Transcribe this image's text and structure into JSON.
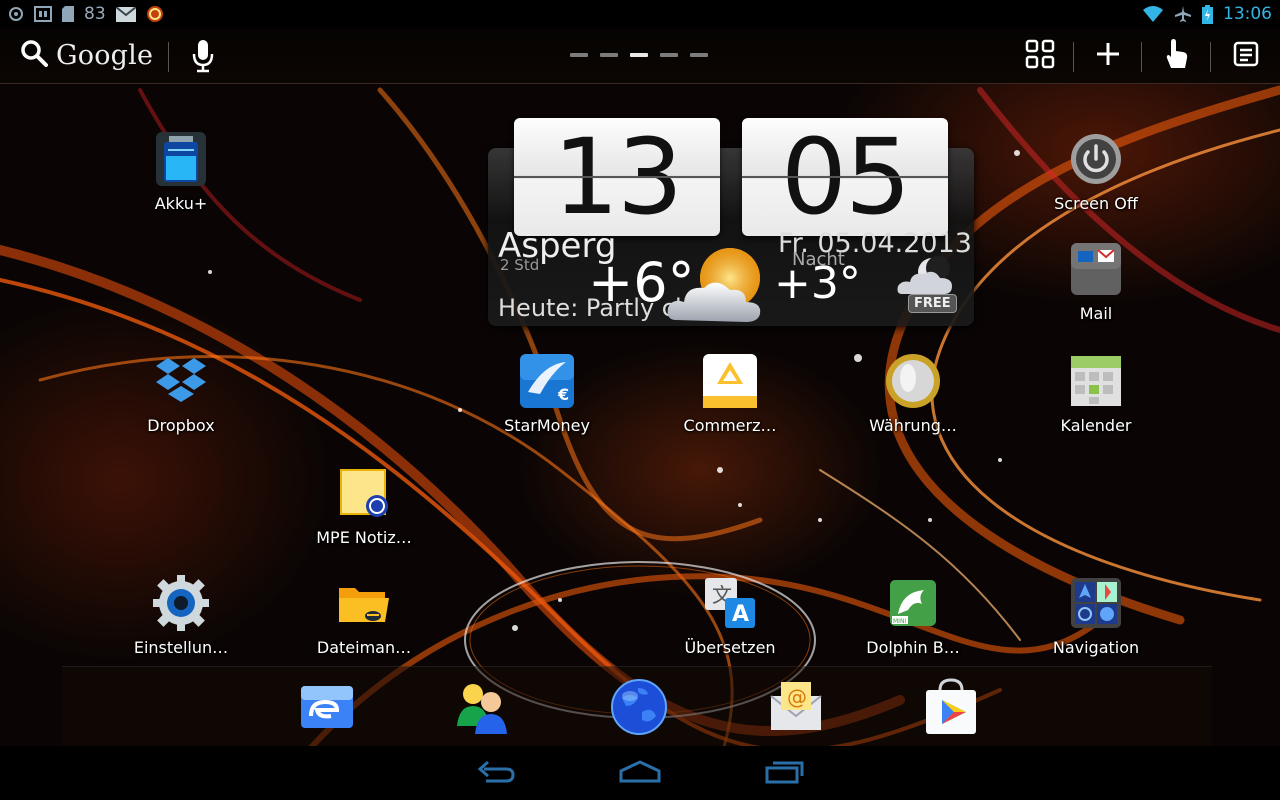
{
  "status_bar": {
    "left_icons": [
      "sync-icon",
      "media-icon",
      "sd-card-icon",
      "gmail-icon",
      "alarm-icon"
    ],
    "battery_level_text": "83",
    "time": "13:06",
    "right_icons": [
      "wifi-icon",
      "airplane-icon",
      "battery-charging-icon"
    ],
    "accent_color": "#33b5e5"
  },
  "action_bar": {
    "search_label": "Google",
    "page_indicator": {
      "count": 5,
      "active_index": 2
    },
    "buttons": [
      "apps-grid-icon",
      "add-icon",
      "touch-gesture-icon",
      "menu-list-icon"
    ]
  },
  "desktop": {
    "apps": [
      {
        "label": "Akku+",
        "icon": "battery-app-icon"
      },
      {
        "label": "Screen Off",
        "icon": "power-icon"
      },
      {
        "label": "Mail",
        "icon": "mail-app-icon"
      },
      {
        "label": "Dropbox",
        "icon": "dropbox-icon"
      },
      {
        "label": "StarMoney",
        "icon": "starmoney-icon"
      },
      {
        "label": "Commerz…",
        "icon": "commerzbank-icon"
      },
      {
        "label": "Währung…",
        "icon": "coin-icon"
      },
      {
        "label": "Kalender",
        "icon": "calendar-icon"
      },
      {
        "label": "MPE Notiz…",
        "icon": "note-icon"
      },
      {
        "label": "Einstellun…",
        "icon": "settings-gear-icon"
      },
      {
        "label": "Dateiman…",
        "icon": "file-manager-icon"
      },
      {
        "label": "Übersetzen",
        "icon": "translate-icon"
      },
      {
        "label": "Dolphin B…",
        "icon": "dolphin-browser-icon"
      },
      {
        "label": "Navigation",
        "icon": "navigation-icon"
      }
    ]
  },
  "clock_widget": {
    "hours": "13",
    "minutes": "05",
    "city": "Asperg",
    "updated": "2 Std",
    "temp_now": "+6°",
    "date": "Fr. 05.04.2013",
    "night_label": "Nacht",
    "temp_night": "+3°",
    "forecast": "Heute: Partly clo",
    "badge": "FREE",
    "weather_icon": "partly-cloudy-icon",
    "night_icon": "cloudy-moon-icon"
  },
  "dock": {
    "items": [
      "email-client-icon",
      "contacts-icon",
      "browser-globe-icon",
      "email-envelope-icon",
      "play-store-icon"
    ]
  },
  "nav_bar": {
    "buttons": [
      "back-icon",
      "home-icon",
      "recent-apps-icon"
    ],
    "color": "#2a6fa8"
  }
}
